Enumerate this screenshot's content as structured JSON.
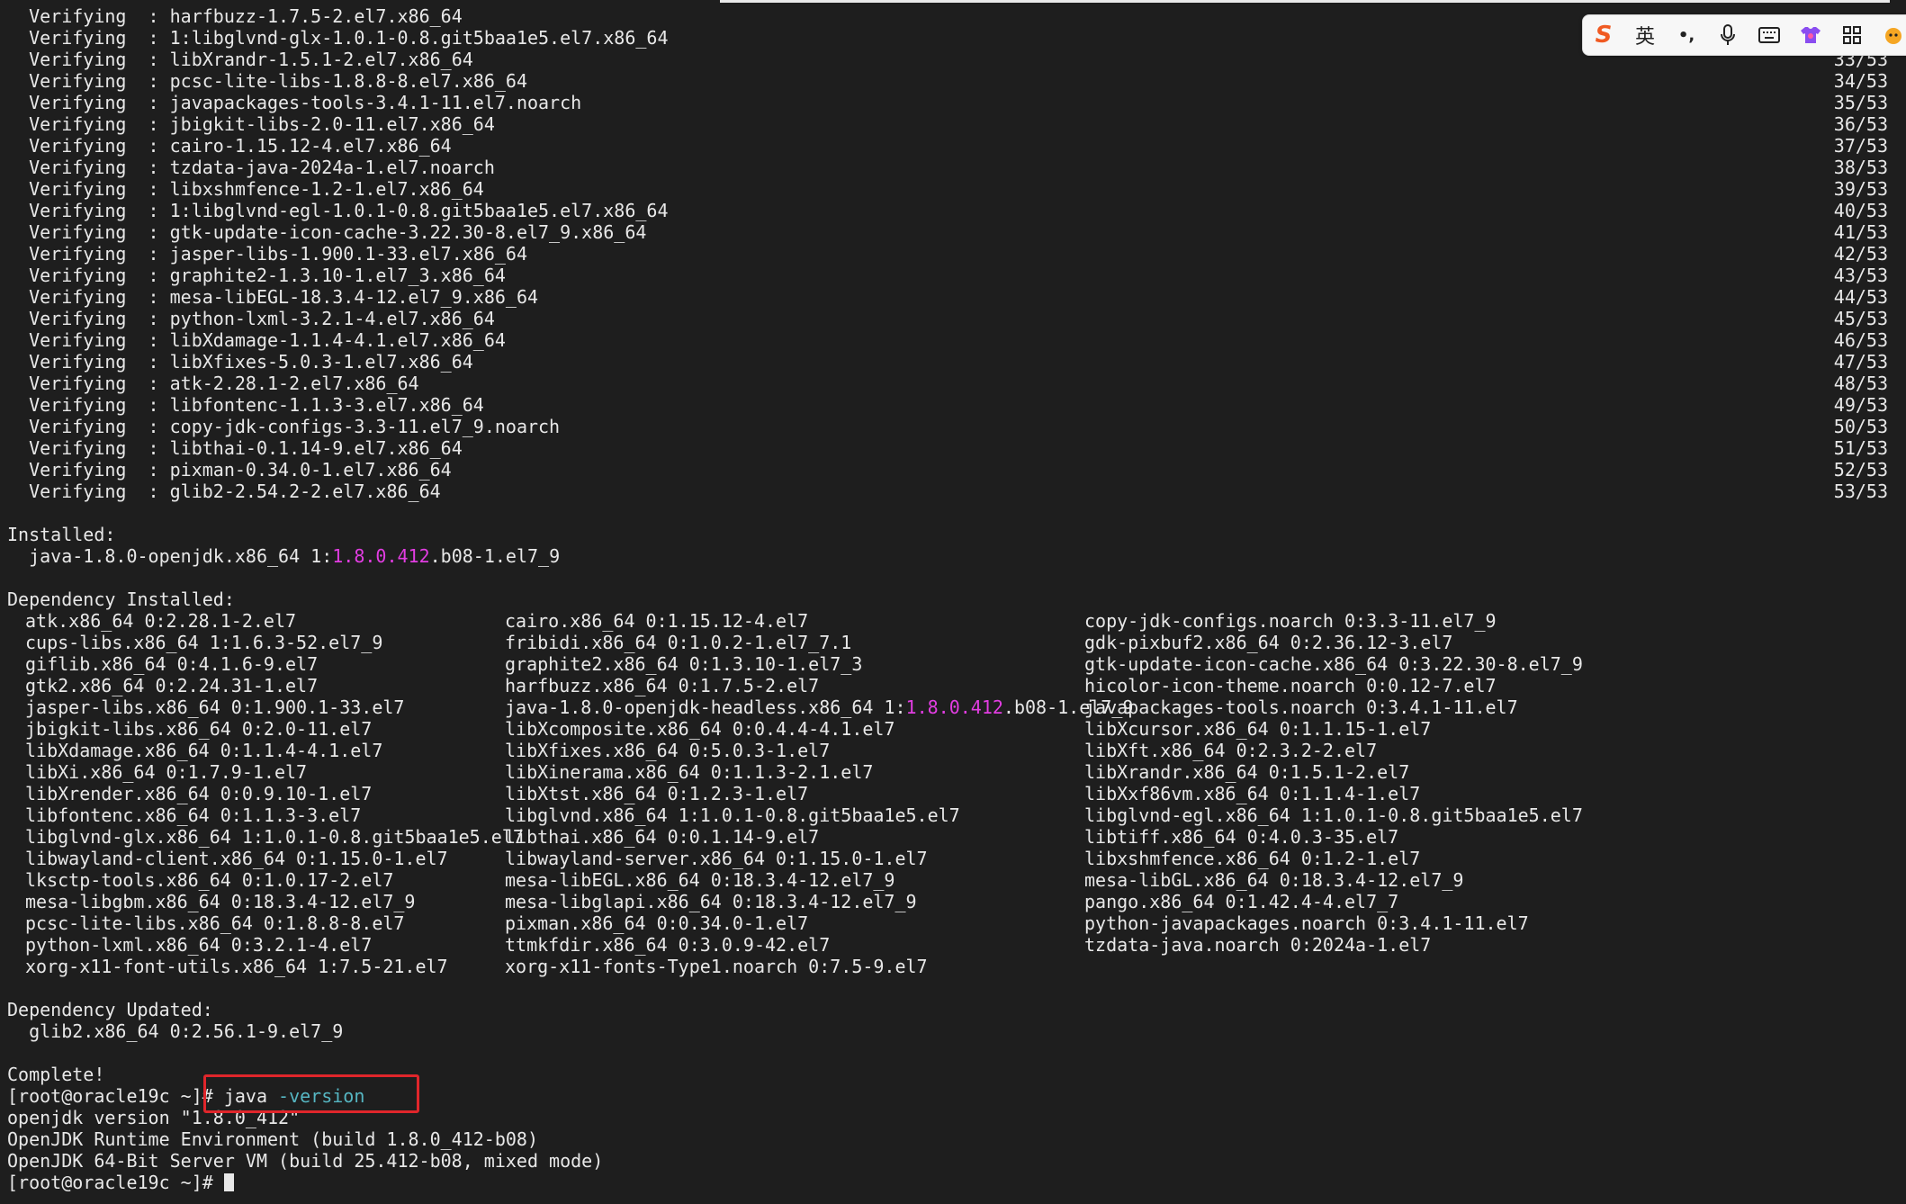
{
  "verifying": [
    {
      "label": "Verifying",
      "pkg": "harfbuzz-1.7.5-2.el7.x86_64",
      "count": ""
    },
    {
      "label": "Verifying",
      "pkg": "1:libglvnd-glx-1.0.1-0.8.git5baa1e5.el7.x86_64",
      "count": ""
    },
    {
      "label": "Verifying",
      "pkg": "libXrandr-1.5.1-2.el7.x86_64",
      "count": "33/53"
    },
    {
      "label": "Verifying",
      "pkg": "pcsc-lite-libs-1.8.8-8.el7.x86_64",
      "count": "34/53"
    },
    {
      "label": "Verifying",
      "pkg": "javapackages-tools-3.4.1-11.el7.noarch",
      "count": "35/53"
    },
    {
      "label": "Verifying",
      "pkg": "jbigkit-libs-2.0-11.el7.x86_64",
      "count": "36/53"
    },
    {
      "label": "Verifying",
      "pkg": "cairo-1.15.12-4.el7.x86_64",
      "count": "37/53"
    },
    {
      "label": "Verifying",
      "pkg": "tzdata-java-2024a-1.el7.noarch",
      "count": "38/53"
    },
    {
      "label": "Verifying",
      "pkg": "libxshmfence-1.2-1.el7.x86_64",
      "count": "39/53"
    },
    {
      "label": "Verifying",
      "pkg": "1:libglvnd-egl-1.0.1-0.8.git5baa1e5.el7.x86_64",
      "count": "40/53"
    },
    {
      "label": "Verifying",
      "pkg": "gtk-update-icon-cache-3.22.30-8.el7_9.x86_64",
      "count": "41/53"
    },
    {
      "label": "Verifying",
      "pkg": "jasper-libs-1.900.1-33.el7.x86_64",
      "count": "42/53"
    },
    {
      "label": "Verifying",
      "pkg": "graphite2-1.3.10-1.el7_3.x86_64",
      "count": "43/53"
    },
    {
      "label": "Verifying",
      "pkg": "mesa-libEGL-18.3.4-12.el7_9.x86_64",
      "count": "44/53"
    },
    {
      "label": "Verifying",
      "pkg": "python-lxml-3.2.1-4.el7.x86_64",
      "count": "45/53"
    },
    {
      "label": "Verifying",
      "pkg": "libXdamage-1.1.4-4.1.el7.x86_64",
      "count": "46/53"
    },
    {
      "label": "Verifying",
      "pkg": "libXfixes-5.0.3-1.el7.x86_64",
      "count": "47/53"
    },
    {
      "label": "Verifying",
      "pkg": "atk-2.28.1-2.el7.x86_64",
      "count": "48/53"
    },
    {
      "label": "Verifying",
      "pkg": "libfontenc-1.1.3-3.el7.x86_64",
      "count": "49/53"
    },
    {
      "label": "Verifying",
      "pkg": "copy-jdk-configs-3.3-11.el7_9.noarch",
      "count": "50/53"
    },
    {
      "label": "Verifying",
      "pkg": "libthai-0.1.14-9.el7.x86_64",
      "count": "51/53"
    },
    {
      "label": "Verifying",
      "pkg": "pixman-0.34.0-1.el7.x86_64",
      "count": "52/53"
    },
    {
      "label": "Verifying",
      "pkg": "glib2-2.54.2-2.el7.x86_64",
      "count": "53/53"
    }
  ],
  "installed": {
    "header": "Installed:",
    "pre": "java-1.8.0-openjdk.x86_64 1:",
    "ver": "1.8.0.412",
    "post": ".b08-1.el7_9"
  },
  "dep_installed": {
    "header": "Dependency Installed:",
    "rows": [
      [
        "atk.x86_64 0:2.28.1-2.el7",
        "cairo.x86_64 0:1.15.12-4.el7",
        "copy-jdk-configs.noarch 0:3.3-11.el7_9"
      ],
      [
        "cups-libs.x86_64 1:1.6.3-52.el7_9",
        "fribidi.x86_64 0:1.0.2-1.el7_7.1",
        "gdk-pixbuf2.x86_64 0:2.36.12-3.el7"
      ],
      [
        "giflib.x86_64 0:4.1.6-9.el7",
        "graphite2.x86_64 0:1.3.10-1.el7_3",
        "gtk-update-icon-cache.x86_64 0:3.22.30-8.el7_9"
      ],
      [
        "gtk2.x86_64 0:2.24.31-1.el7",
        "harfbuzz.x86_64 0:1.7.5-2.el7",
        "hicolor-icon-theme.noarch 0:0.12-7.el7"
      ],
      [
        "jasper-libs.x86_64 0:1.900.1-33.el7",
        "",
        "javapackages-tools.noarch 0:3.4.1-11.el7"
      ],
      [
        "jbigkit-libs.x86_64 0:2.0-11.el7",
        "libXcomposite.x86_64 0:0.4.4-4.1.el7",
        "libXcursor.x86_64 0:1.1.15-1.el7"
      ],
      [
        "libXdamage.x86_64 0:1.1.4-4.1.el7",
        "libXfixes.x86_64 0:5.0.3-1.el7",
        "libXft.x86_64 0:2.3.2-2.el7"
      ],
      [
        "libXi.x86_64 0:1.7.9-1.el7",
        "libXinerama.x86_64 0:1.1.3-2.1.el7",
        "libXrandr.x86_64 0:1.5.1-2.el7"
      ],
      [
        "libXrender.x86_64 0:0.9.10-1.el7",
        "libXtst.x86_64 0:1.2.3-1.el7",
        "libXxf86vm.x86_64 0:1.1.4-1.el7"
      ],
      [
        "libfontenc.x86_64 0:1.1.3-3.el7",
        "libglvnd.x86_64 1:1.0.1-0.8.git5baa1e5.el7",
        "libglvnd-egl.x86_64 1:1.0.1-0.8.git5baa1e5.el7"
      ],
      [
        "libglvnd-glx.x86_64 1:1.0.1-0.8.git5baa1e5.el7",
        "libthai.x86_64 0:0.1.14-9.el7",
        "libtiff.x86_64 0:4.0.3-35.el7"
      ],
      [
        "libwayland-client.x86_64 0:1.15.0-1.el7",
        "libwayland-server.x86_64 0:1.15.0-1.el7",
        "libxshmfence.x86_64 0:1.2-1.el7"
      ],
      [
        "lksctp-tools.x86_64 0:1.0.17-2.el7",
        "mesa-libEGL.x86_64 0:18.3.4-12.el7_9",
        "mesa-libGL.x86_64 0:18.3.4-12.el7_9"
      ],
      [
        "mesa-libgbm.x86_64 0:18.3.4-12.el7_9",
        "mesa-libglapi.x86_64 0:18.3.4-12.el7_9",
        "pango.x86_64 0:1.42.4-4.el7_7"
      ],
      [
        "pcsc-lite-libs.x86_64 0:1.8.8-8.el7",
        "pixman.x86_64 0:0.34.0-1.el7",
        "python-javapackages.noarch 0:3.4.1-11.el7"
      ],
      [
        "python-lxml.x86_64 0:3.2.1-4.el7",
        "ttmkfdir.x86_64 0:3.0.9-42.el7",
        "tzdata-java.noarch 0:2024a-1.el7"
      ],
      [
        "xorg-x11-font-utils.x86_64 1:7.5-21.el7",
        "xorg-x11-fonts-Type1.noarch 0:7.5-9.el7",
        ""
      ]
    ],
    "headless": {
      "pre": "java-1.8.0-openjdk-headless.x86_64 1:",
      "ver": "1.8.0.412",
      "post": ".b08-1.el7_9"
    }
  },
  "dep_updated": {
    "header": "Dependency Updated:",
    "pkg": "glib2.x86_64 0:2.56.1-9.el7_9"
  },
  "complete": "Complete!",
  "prompt": "[root@oracle19c ~]# ",
  "command": {
    "cmd": "java",
    "opt": "-version"
  },
  "output": [
    "openjdk version \"1.8.0_412\"",
    "OpenJDK Runtime Environment (build 1.8.0_412-b08)",
    "OpenJDK 64-Bit Server VM (build 25.412-b08, mixed mode)"
  ],
  "ime": {
    "logo": "S",
    "lang": "英",
    "punct": "•,",
    "mic": "mic-icon",
    "keyboard": "keyboard-icon",
    "skin": "shirt-icon",
    "menu": "grid-icon"
  },
  "colors": {
    "bg": "#1e1e1e",
    "fg": "#e8e8e8",
    "version_highlight": "#e23de2",
    "option": "#56b6c2",
    "annotation": "#e0262b"
  }
}
